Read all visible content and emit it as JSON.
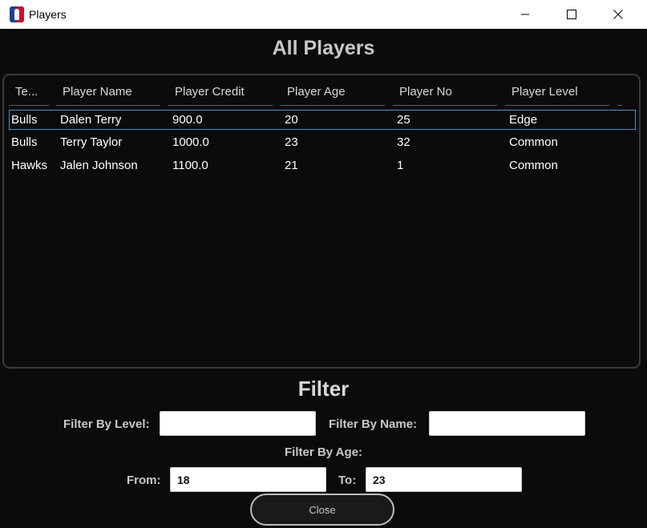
{
  "window": {
    "title": "Players"
  },
  "page": {
    "title": "All Players"
  },
  "table": {
    "columns": [
      "Te...",
      "Player Name",
      "Player Credit",
      "Player Age",
      "Player No",
      "Player Level"
    ],
    "rows": [
      [
        "Bulls",
        "Dalen Terry",
        "900.0",
        "20",
        "25",
        "Edge"
      ],
      [
        "Bulls",
        "Terry Taylor",
        "1000.0",
        "23",
        "32",
        "Common"
      ],
      [
        "Hawks",
        "Jalen Johnson",
        "1100.0",
        "21",
        "1",
        "Common"
      ]
    ]
  },
  "filter": {
    "title": "Filter",
    "level_label": "Filter By Level:",
    "level_value": "",
    "name_label": "Filter By Name:",
    "name_value": "",
    "age_label": "Filter By Age:",
    "from_label": "From:",
    "from_value": "18",
    "to_label": "To:",
    "to_value": "23"
  },
  "actions": {
    "close_label": "Close"
  },
  "colors": {
    "background": "#0b0b0d",
    "selection_border": "#4a8fc4",
    "brand_blue": "#1d428a",
    "brand_red": "#c8102e"
  }
}
